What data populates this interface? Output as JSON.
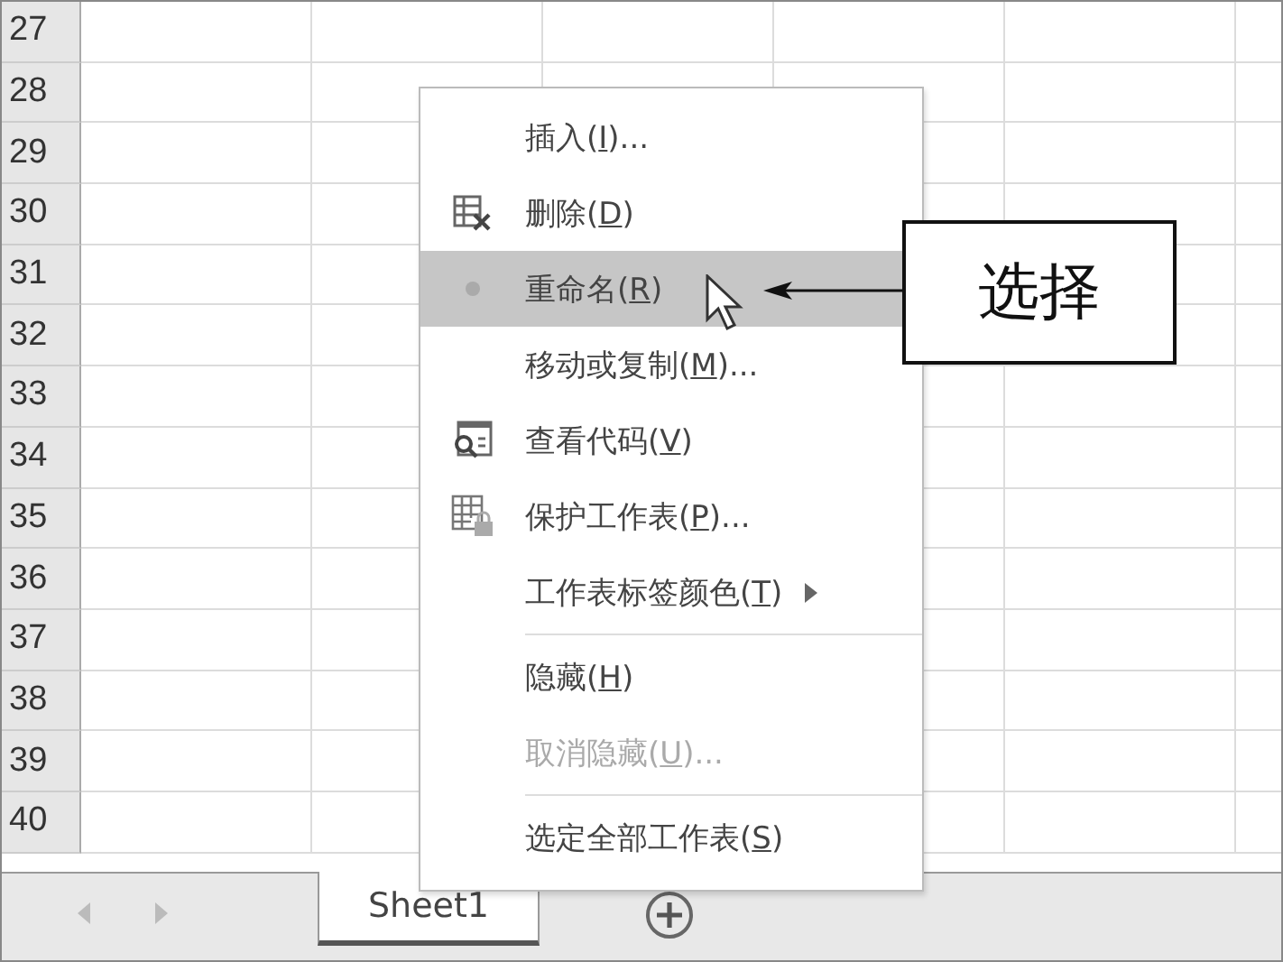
{
  "rows": [
    "27",
    "28",
    "29",
    "30",
    "31",
    "32",
    "33",
    "34",
    "35",
    "36",
    "37",
    "38",
    "39",
    "40"
  ],
  "context_menu": {
    "items": [
      {
        "kind": "item",
        "label": "插入(",
        "key": "I",
        "after": ")...",
        "selected": false,
        "disabled": false,
        "submenu": false
      },
      {
        "kind": "item",
        "label": "删除(",
        "key": "D",
        "after": ")",
        "selected": false,
        "disabled": false,
        "submenu": false
      },
      {
        "kind": "item",
        "label": "重命名(",
        "key": "R",
        "after": ")",
        "selected": true,
        "disabled": false,
        "submenu": false
      },
      {
        "kind": "item",
        "label": "移动或复制(",
        "key": "M",
        "after": ")...",
        "selected": false,
        "disabled": false,
        "submenu": false
      },
      {
        "kind": "item",
        "label": "查看代码(",
        "key": "V",
        "after": ")",
        "selected": false,
        "disabled": false,
        "submenu": false
      },
      {
        "kind": "item",
        "label": "保护工作表(",
        "key": "P",
        "after": ")...",
        "selected": false,
        "disabled": false,
        "submenu": false
      },
      {
        "kind": "item",
        "label": "工作表标签颜色(",
        "key": "T",
        "after": ")",
        "selected": false,
        "disabled": false,
        "submenu": true
      },
      {
        "kind": "separator"
      },
      {
        "kind": "item",
        "label": "隐藏(",
        "key": "H",
        "after": ")",
        "selected": false,
        "disabled": false,
        "submenu": false
      },
      {
        "kind": "item",
        "label": "取消隐藏(",
        "key": "U",
        "after": ")...",
        "selected": false,
        "disabled": true,
        "submenu": false
      },
      {
        "kind": "separator"
      },
      {
        "kind": "item",
        "label": "选定全部工作表(",
        "key": "S",
        "after": ")",
        "selected": false,
        "disabled": false,
        "submenu": false
      }
    ]
  },
  "callout": {
    "text": "选择"
  },
  "sheet_tabs": [
    {
      "label": "Sheet1",
      "selected": true
    }
  ]
}
